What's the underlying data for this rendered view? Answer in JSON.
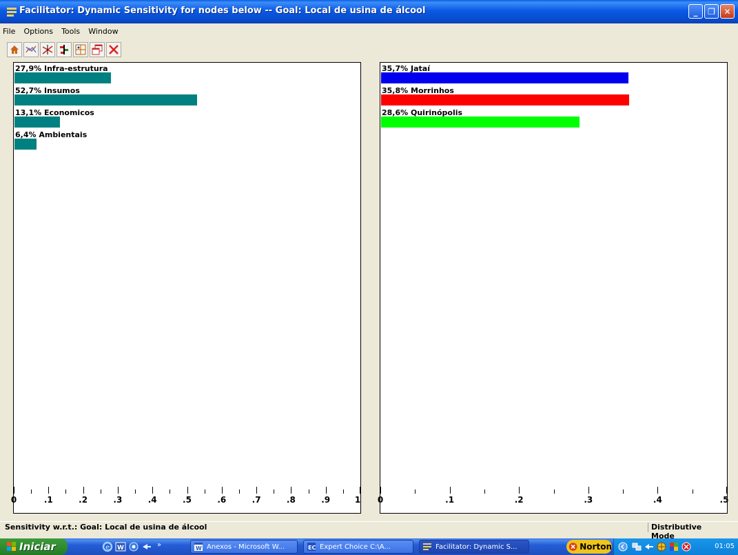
{
  "window": {
    "title": "Facilitator: Dynamic Sensitivity for nodes below -- Goal: Local de usina de álcool",
    "caption_buttons": {
      "minimize": "_",
      "restore": "❐",
      "close": "✕"
    }
  },
  "menu": {
    "items": [
      "File",
      "Options",
      "Tools",
      "Window"
    ]
  },
  "toolbar": {
    "icons": [
      "home-icon",
      "performance-graph-icon",
      "gradient-graph-icon",
      "head-to-head-icon",
      "two-d-plot-icon",
      "windows-icon",
      "close-icon"
    ]
  },
  "chart_data": [
    {
      "type": "bar",
      "orientation": "horizontal",
      "title": "",
      "categories": [
        "27,9% Infra-estrutura",
        "52,7% Insumos",
        "13,1% Economicos",
        "6,4% Ambientais"
      ],
      "values": [
        0.279,
        0.527,
        0.131,
        0.064
      ],
      "colors": [
        "#008080",
        "#008080",
        "#008080",
        "#008080"
      ],
      "xlim": [
        0,
        1
      ],
      "ticks": [
        0,
        0.1,
        0.2,
        0.3,
        0.4,
        0.5,
        0.6,
        0.7,
        0.8,
        0.9,
        1
      ],
      "tick_labels": [
        "0",
        ".1",
        ".2",
        ".3",
        ".4",
        ".5",
        ".6",
        ".7",
        ".8",
        ".9",
        "1"
      ]
    },
    {
      "type": "bar",
      "orientation": "horizontal",
      "title": "",
      "categories": [
        "35,7% Jataí",
        "35,8% Morrinhos",
        "28,6% Quirinópolis"
      ],
      "values": [
        0.357,
        0.358,
        0.286
      ],
      "colors": [
        "#0000ee",
        "#ff0000",
        "#00ff00"
      ],
      "xlim": [
        0,
        0.5
      ],
      "ticks": [
        0,
        0.1,
        0.2,
        0.3,
        0.4,
        0.5
      ],
      "tick_labels": [
        "0",
        ".1",
        ".2",
        ".3",
        ".4",
        ".5"
      ]
    }
  ],
  "status": {
    "left": "Sensitivity w.r.t.: Goal: Local de usina de álcool",
    "right": "Distributive Mode"
  },
  "taskbar": {
    "start_label": "Iniciar",
    "quicklaunch_more": "»",
    "tasks": [
      {
        "label": "Anexos - Microsoft W..."
      },
      {
        "label": "Expert Choice   C:\\A..."
      },
      {
        "label": "Facilitator: Dynamic S..."
      }
    ],
    "norton": "Norton",
    "clock": "01:05"
  }
}
